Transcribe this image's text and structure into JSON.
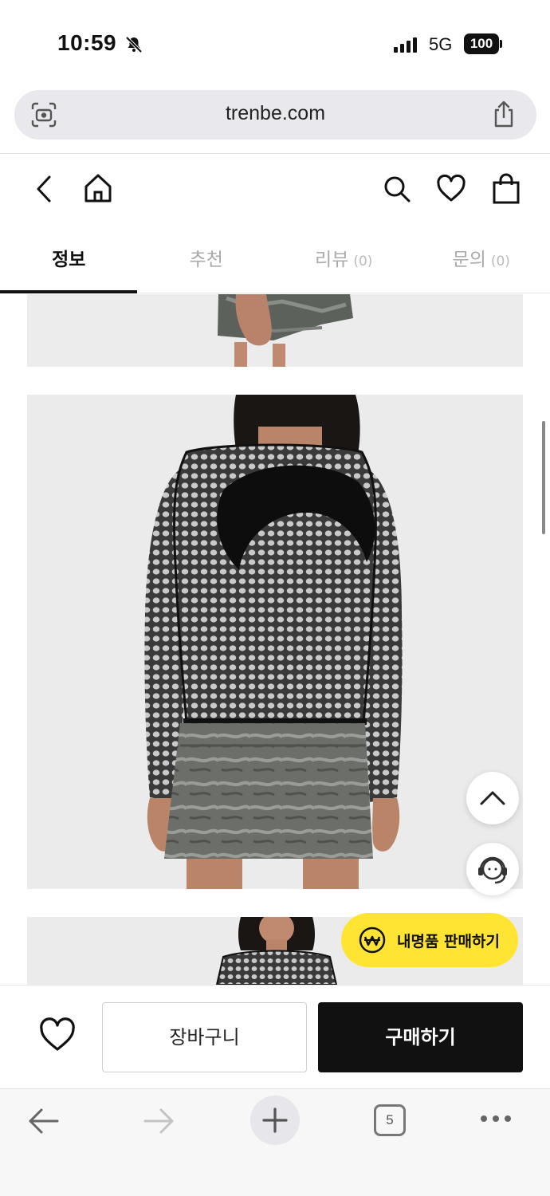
{
  "status_bar": {
    "time": "10:59",
    "network": "5G",
    "battery": "100"
  },
  "browser": {
    "url": "trenbe.com",
    "tab_count": "5"
  },
  "header": {
    "icons": [
      "back-icon",
      "home-icon",
      "search-icon",
      "heart-icon",
      "shopping-bag-icon"
    ]
  },
  "tabs": [
    {
      "label": "정보",
      "count": ""
    },
    {
      "label": "추천",
      "count": ""
    },
    {
      "label": "리뷰",
      "count": "(0)"
    },
    {
      "label": "문의",
      "count": "(0)"
    }
  ],
  "floating": {
    "sell_label": "내명품 판매하기"
  },
  "purchase_bar": {
    "cart_label": "장바구니",
    "buy_label": "구매하기"
  },
  "colors": {
    "accent_yellow": "#ffe433",
    "primary_black": "#111111"
  }
}
